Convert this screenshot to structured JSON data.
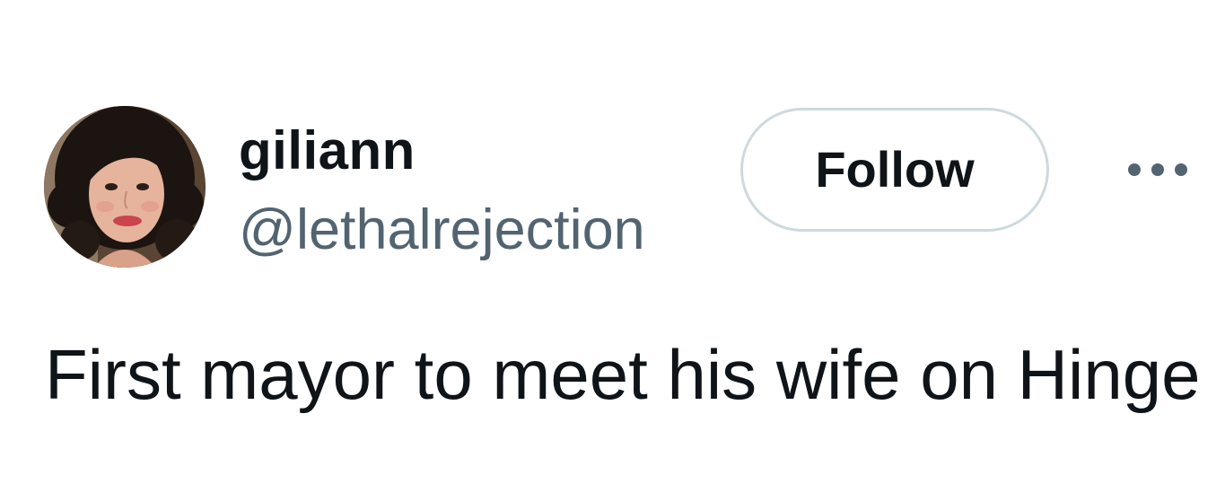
{
  "tweet": {
    "author": {
      "display_name": "giliann",
      "handle": "@lethalrejection",
      "avatar_icon": "profile-photo"
    },
    "actions": {
      "follow_label": "Follow",
      "more_icon": "more-horizontal-icon"
    },
    "text": "First mayor to meet his wife on Hinge"
  },
  "colors": {
    "primary_text": "#0f1419",
    "secondary_text": "#536471",
    "button_border": "#cfd9de",
    "background": "#ffffff"
  }
}
